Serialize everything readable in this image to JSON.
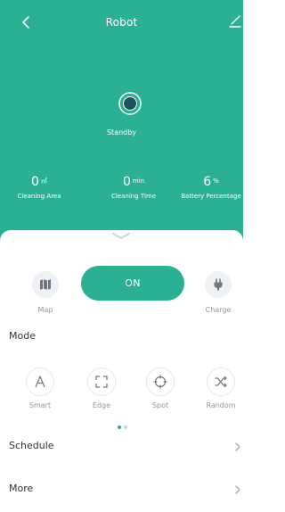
{
  "header": {
    "title": "Robot"
  },
  "status": {
    "text": "Standby"
  },
  "stats": [
    {
      "value": "0",
      "unit": "㎡",
      "label": "Cleaning Area"
    },
    {
      "value": "0",
      "unit": "min",
      "label": "Cleaning Time"
    },
    {
      "value": "6",
      "unit": "%",
      "label": "Battery Percentage"
    }
  ],
  "controls": {
    "map_label": "Map",
    "power_label": "ON",
    "charge_label": "Charge"
  },
  "mode": {
    "title": "Mode",
    "items": [
      {
        "label": "Smart"
      },
      {
        "label": "Edge"
      },
      {
        "label": "Spot"
      },
      {
        "label": "Random"
      }
    ]
  },
  "menu": {
    "schedule_label": "Schedule",
    "more_label": "More"
  },
  "colors": {
    "accent": "#2bb094",
    "background": "#ffffff"
  },
  "icons": {
    "back": "chevron-left-icon",
    "edit": "pencil-icon",
    "status": "robot-status-icon",
    "map": "map-icon",
    "charge": "plug-icon",
    "smart": "letter-a-icon",
    "edge": "corner-frame-icon",
    "spot": "crosshair-icon",
    "random": "shuffle-icon"
  }
}
